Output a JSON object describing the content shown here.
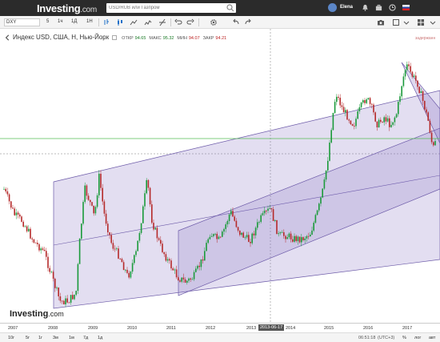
{
  "brand": {
    "name": "Investing",
    "suffix": ".com"
  },
  "search": {
    "placeholder": "USD/RUB или Газпром"
  },
  "user": {
    "name": "Elena"
  },
  "toolbar": {
    "symbol": "DXY",
    "timeframes": [
      "5",
      "1ч",
      "1Д",
      "1Н"
    ],
    "active_timeframe": "1Н"
  },
  "legend": {
    "title": "Индекс USD, США, Н, Нью-Йорк",
    "open_label": "ОТКР",
    "open": "94.65",
    "high_label": "МАКС",
    "high": "95.32",
    "low_label": "МИН",
    "low": "94.07",
    "close_label": "ЗАКР",
    "close": "94.21"
  },
  "drawing_label": "задержанн",
  "x_axis": {
    "ticks": [
      "2007",
      "2008",
      "2009",
      "2010",
      "2011",
      "2012",
      "2013",
      "2014",
      "2015",
      "2016",
      "2017"
    ],
    "cursor_date": "2013-06-17"
  },
  "watermark": {
    "name": "Investing",
    "suffix": ".com"
  },
  "bottom": {
    "ranges": [
      "10г",
      "5г",
      "1г",
      "3м",
      "1м",
      "7д",
      "1д"
    ],
    "clock": "06:51:18",
    "timezone": "(UTC+3)",
    "percent_label": "%",
    "log_label": "лог",
    "auto_label": "авт"
  },
  "colors": {
    "up_candle": "#1a9a3a",
    "down_candle": "#b52a2a",
    "channel_fill": "#7e68bf",
    "channel_line": "#6c5aa8",
    "horizontal_line": "#55bb55",
    "topbar": "#2b2b2b"
  }
}
